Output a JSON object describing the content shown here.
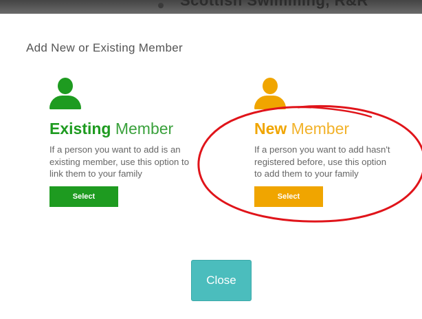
{
  "header": {
    "clipped_title": "Scottish Swimming, R&R"
  },
  "modal": {
    "title": "Add New or Existing Member",
    "close_label": "Close"
  },
  "options": {
    "existing": {
      "heading_strong": "Existing",
      "heading_rest": " Member",
      "desc_lines": [
        "If a person you want to add is an",
        "existing member, use this option to",
        "link them to your family"
      ],
      "button_label": "Select",
      "color": "#1e9b20"
    },
    "new": {
      "heading_strong": "New",
      "heading_rest": " Member",
      "desc_lines": [
        "If a person you want to add hasn't",
        "registered before, use this option",
        "to add them to your family"
      ],
      "button_label": "Select",
      "color": "#f0a500"
    }
  },
  "annotation": {
    "circle_color": "#e0141a"
  },
  "icons": {
    "existing": "person-icon",
    "new": "person-icon"
  }
}
